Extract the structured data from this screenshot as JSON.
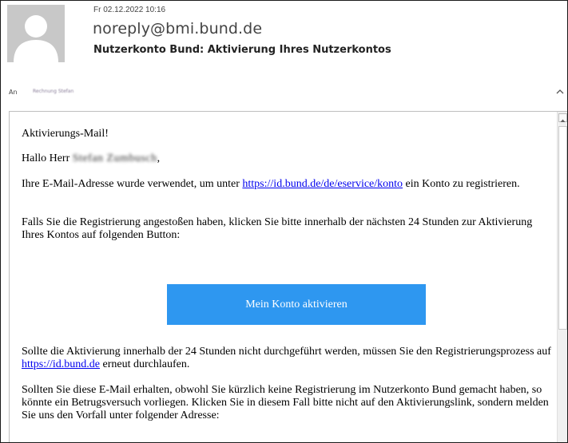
{
  "header": {
    "date": "Fr 02.12.2022 10:16",
    "sender": "noreply@bmi.bund.de",
    "subject": "Nutzerkonto Bund: Aktivierung Ihres Nutzerkontos",
    "to_label": "An",
    "to_name": "Rechnung Stefan"
  },
  "email": {
    "greeting_title": "Aktivierungs-Mail!",
    "salutation_prefix": "Hallo Herr",
    "salutation_name": "Stefan Zumbusch",
    "salutation_suffix": ",",
    "para1_before": "Ihre E-Mail-Adresse wurde verwendet, um unter ",
    "para1_link": "https://id.bund.de/de/eservice/konto",
    "para1_after": " ein Konto zu registrieren.",
    "para2": "Falls Sie die Registrierung angestoßen haben, klicken Sie bitte innerhalb der nächsten 24 Stunden zur Aktivierung Ihres Kontos auf folgenden Button:",
    "button_label": "Mein Konto aktivieren",
    "para3_before": "Sollte die Aktivierung innerhalb der 24 Stunden nicht durchgeführt werden, müssen Sie den Registrierungsprozess auf ",
    "para3_link": "https://id.bund.de",
    "para3_after": " erneut durchlaufen.",
    "para4": "Sollten Sie diese E-Mail erhalten, obwohl Sie kürzlich keine Registrierung im Nutzerkonto Bund gemacht haben, so könnte ein Betrugsversuch vorliegen. Klicken Sie in diesem Fall bitte nicht auf den Aktivierungslink, sondern melden Sie uns den Vorfall unter folgender Adresse:"
  },
  "colors": {
    "button": "#2e97f0",
    "link": "#0000ee",
    "avatar_bg": "#c8c8c8"
  },
  "icons": {
    "avatar": "person-silhouette-icon",
    "collapse": "chevron-up-icon",
    "scroll_up": "triangle-up-icon"
  }
}
